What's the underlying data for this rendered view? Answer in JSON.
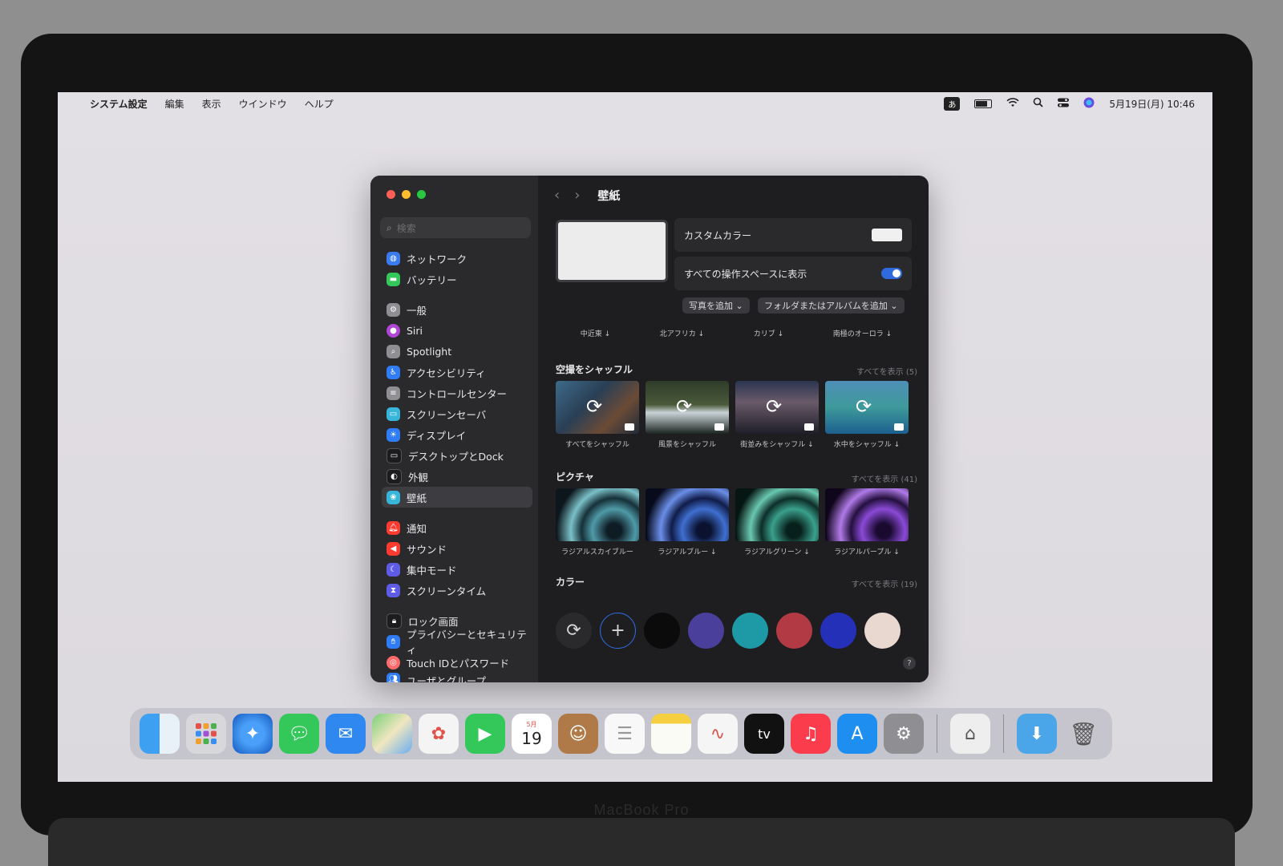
{
  "menubar": {
    "app_name": "システム設定",
    "items": [
      "編集",
      "表示",
      "ウインドウ",
      "ヘルプ"
    ],
    "ime_label": "あ",
    "datetime": "5月19日(月) 10:46"
  },
  "sidebar": {
    "search_placeholder": "検索",
    "items": [
      {
        "label": "ネットワーク",
        "color": "#3a7bf0"
      },
      {
        "label": "バッテリー",
        "color": "#34c759"
      },
      {
        "label": "一般",
        "color": "#8e8e93"
      },
      {
        "label": "Siri",
        "color": "#b045d6"
      },
      {
        "label": "Spotlight",
        "color": "#8e8e93"
      },
      {
        "label": "アクセシビリティ",
        "color": "#2f7cf6"
      },
      {
        "label": "コントロールセンター",
        "color": "#8e8e93"
      },
      {
        "label": "スクリーンセーバ",
        "color": "#37b6d9"
      },
      {
        "label": "ディスプレイ",
        "color": "#2f7cf6"
      },
      {
        "label": "デスクトップとDock",
        "color": "#1c1c1e"
      },
      {
        "label": "外観",
        "color": "#1c1c1e"
      },
      {
        "label": "壁紙",
        "color": "#37b6d9"
      },
      {
        "label": "通知",
        "color": "#ff3b30"
      },
      {
        "label": "サウンド",
        "color": "#ff3b30"
      },
      {
        "label": "集中モード",
        "color": "#5e5ce6"
      },
      {
        "label": "スクリーンタイム",
        "color": "#5e5ce6"
      },
      {
        "label": "ロック画面",
        "color": "#1c1c1e"
      },
      {
        "label": "プライバシーとセキュリティ",
        "color": "#2f7cf6"
      },
      {
        "label": "Touch IDとパスワード",
        "color": "#ff6b6b"
      },
      {
        "label": "ユーザとグループ",
        "color": "#2f7cf6"
      }
    ]
  },
  "content": {
    "title": "壁紙",
    "custom_color_label": "カスタムカラー",
    "show_all_spaces_label": "すべての操作スペースに表示",
    "add_photo_label": "写真を追加",
    "add_folder_label": "フォルダまたはアルバムを追加",
    "scroll_labels": [
      "中近東 ↓",
      "北アフリカ ↓",
      "カリブ ↓",
      "南極のオーロラ ↓"
    ],
    "shuffle": {
      "title": "空撮をシャッフル",
      "more": "すべてを表示 (5)",
      "items": [
        "すべてをシャッフル",
        "風景をシャッフル",
        "街並みをシャッフル ↓",
        "水中をシャッフル ↓"
      ]
    },
    "pictures": {
      "title": "ピクチャ",
      "more": "すべてを表示 (41)",
      "items": [
        "ラジアルスカイブルー",
        "ラジアルブルー ↓",
        "ラジアルグリーン ↓",
        "ラジアルパープル ↓"
      ]
    },
    "colors": {
      "title": "カラー",
      "more": "すべてを表示 (19)",
      "swatches": [
        "#0b0b0c",
        "#4a3f9a",
        "#1d9aa6",
        "#b23a44",
        "#2430b8",
        "#e9d8cf"
      ]
    },
    "help": "?"
  },
  "bezel_text": "MacBook Pro",
  "dock": {
    "calendar_month": "5月",
    "calendar_day": "19"
  }
}
